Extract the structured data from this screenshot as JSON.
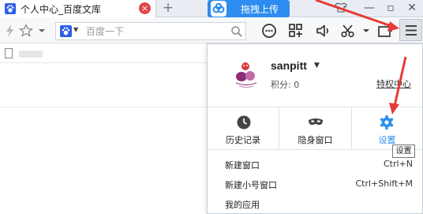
{
  "tabs": [
    {
      "title": "个人中心_百度文库"
    }
  ],
  "upload_button": {
    "label": "拖拽上传"
  },
  "address_bar": {
    "placeholder": "百度一下"
  },
  "profile": {
    "username": "sanpitt",
    "points": "积分: 0",
    "privilege_link": "特权中心"
  },
  "actions": [
    {
      "label": "历史记录",
      "icon": "history-clock-icon"
    },
    {
      "label": "隐身窗口",
      "icon": "incognito-mask-icon"
    },
    {
      "label": "设置",
      "icon": "gear-icon"
    }
  ],
  "menu_items": [
    {
      "label": "新建窗口",
      "shortcut": "Ctrl+N"
    },
    {
      "label": "新建小号窗口",
      "shortcut": "Ctrl+Shift+M"
    },
    {
      "label": "我的应用",
      "shortcut": ""
    }
  ],
  "tooltip": {
    "text": "设置"
  },
  "colors": {
    "accent": "#2d8cf0",
    "arrow": "#e83a36",
    "tab_close": "#e14646"
  }
}
